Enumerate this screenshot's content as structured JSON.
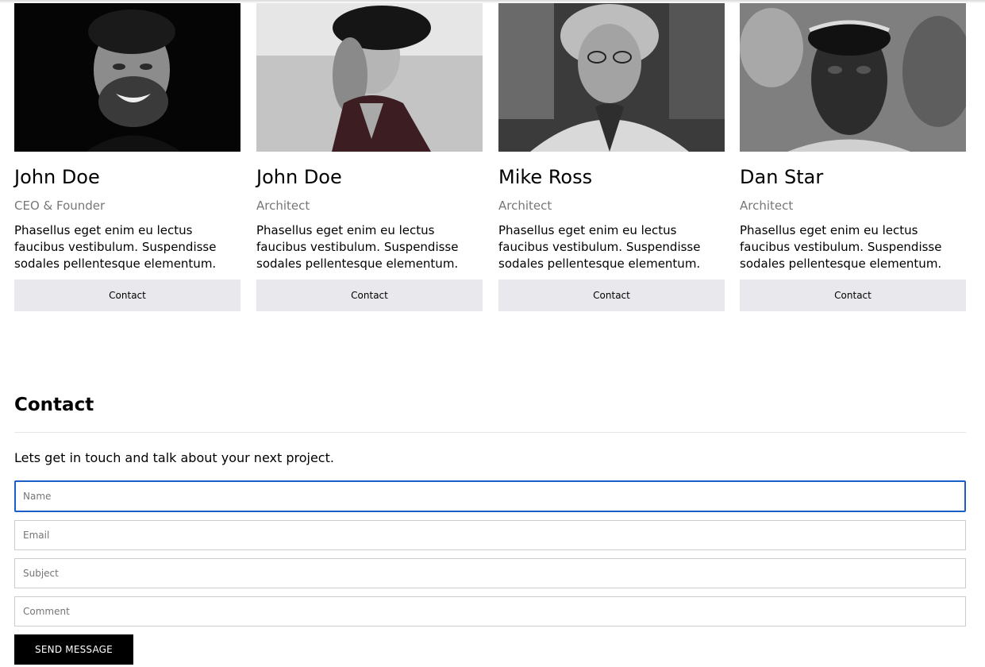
{
  "team": [
    {
      "name": "John Doe",
      "role": "CEO & Founder",
      "bio": "Phasellus eget enim eu lectus faucibus vestibulum. Suspendisse sodales pellentesque elementum.",
      "button": "Contact"
    },
    {
      "name": "John Doe",
      "role": "Architect",
      "bio": "Phasellus eget enim eu lectus faucibus vestibulum. Suspendisse sodales pellentesque elementum.",
      "button": "Contact"
    },
    {
      "name": "Mike Ross",
      "role": "Architect",
      "bio": "Phasellus eget enim eu lectus faucibus vestibulum. Suspendisse sodales pellentesque elementum.",
      "button": "Contact"
    },
    {
      "name": "Dan Star",
      "role": "Architect",
      "bio": "Phasellus eget enim eu lectus faucibus vestibulum. Suspendisse sodales pellentesque elementum.",
      "button": "Contact"
    }
  ],
  "contact": {
    "title": "Contact",
    "lead": "Lets get in touch and talk about your next project.",
    "fields": {
      "name_placeholder": "Name",
      "email_placeholder": "Email",
      "subject_placeholder": "Subject",
      "comment_placeholder": "Comment"
    },
    "submit_label": "SEND MESSAGE"
  },
  "colors": {
    "button_bg": "#e9e8ec",
    "focus_border": "#1a5fc8",
    "submit_bg": "#000000",
    "role_text": "#777777"
  }
}
